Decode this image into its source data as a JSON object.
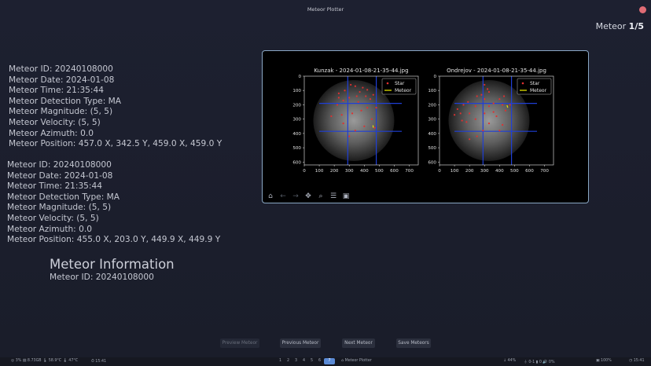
{
  "window": {
    "title": "Meteor Plotter"
  },
  "counter": {
    "label": "Meteor ",
    "value": "1/5"
  },
  "detections": [
    {
      "lines": [
        "Meteor ID: 20240108000",
        "Meteor Date: 2024-01-08",
        "Meteor Time: 21:35:44",
        "Meteor Detection Type: MA",
        "Meteor Magnitude: (5, 5)",
        "Meteor Velocity: (5, 5)",
        "Meteor Azimuth: 0.0",
        "Meteor Position: 457.0 X, 342.5 Y, 459.0 X, 459.0 Y"
      ]
    },
    {
      "lines": [
        "Meteor ID: 20240108000",
        "Meteor Date: 2024-01-08",
        "Meteor Time: 21:35:44",
        "Meteor Detection Type: MA",
        "Meteor Magnitude: (5, 5)",
        "Meteor Velocity: (5, 5)",
        "Meteor Azimuth: 0.0",
        "Meteor Position: 455.0 X, 203.0 Y, 449.9 X, 449.9 Y"
      ]
    }
  ],
  "meteor_info": {
    "title": "Meteor Information",
    "id_line": "Meteor ID: 20240108000"
  },
  "chart_data": [
    {
      "type": "scatter",
      "title": "Kunzak - 2024-01-08-21-35-44.jpg",
      "xticks": [
        "0",
        "100",
        "200",
        "300",
        "400",
        "500",
        "600",
        "700"
      ],
      "yticks": [
        "0",
        "100",
        "200",
        "300",
        "400",
        "500",
        "600"
      ],
      "xlim": [
        0,
        760
      ],
      "ylim": [
        620,
        0
      ],
      "legend": [
        "Star",
        "Meteor"
      ],
      "grid_lines": {
        "x": [
          290,
          480
        ],
        "y": [
          190,
          385
        ]
      },
      "stars": [
        [
          230,
          120
        ],
        [
          270,
          100
        ],
        [
          310,
          60
        ],
        [
          340,
          70
        ],
        [
          370,
          110
        ],
        [
          390,
          80
        ],
        [
          420,
          95
        ],
        [
          410,
          140
        ],
        [
          440,
          160
        ],
        [
          460,
          130
        ],
        [
          300,
          150
        ],
        [
          260,
          170
        ],
        [
          220,
          200
        ],
        [
          180,
          280
        ],
        [
          250,
          270
        ],
        [
          320,
          260
        ],
        [
          380,
          240
        ],
        [
          420,
          220
        ],
        [
          480,
          220
        ],
        [
          360,
          180
        ],
        [
          450,
          300
        ],
        [
          400,
          350
        ],
        [
          300,
          420
        ],
        [
          260,
          330
        ],
        [
          340,
          380
        ],
        [
          470,
          360
        ],
        [
          230,
          150
        ],
        [
          350,
          140
        ]
      ],
      "meteor": [
        [
          458,
          343
        ],
        [
          460,
          360
        ]
      ]
    },
    {
      "type": "scatter",
      "title": "Ondrejov - 2024-01-08-21-35-44.jpg",
      "xticks": [
        "0",
        "100",
        "200",
        "300",
        "400",
        "500",
        "600",
        "700"
      ],
      "yticks": [
        "0",
        "100",
        "200",
        "300",
        "400",
        "500",
        "600"
      ],
      "xlim": [
        0,
        760
      ],
      "ylim": [
        620,
        0
      ],
      "legend": [
        "Star",
        "Meteor"
      ],
      "grid_lines": {
        "x": [
          290,
          480
        ],
        "y": [
          190,
          385
        ]
      },
      "stars": [
        [
          300,
          60
        ],
        [
          320,
          90
        ],
        [
          280,
          130
        ],
        [
          250,
          140
        ],
        [
          190,
          180
        ],
        [
          160,
          200
        ],
        [
          120,
          230
        ],
        [
          100,
          270
        ],
        [
          150,
          310
        ],
        [
          200,
          260
        ],
        [
          240,
          300
        ],
        [
          300,
          260
        ],
        [
          330,
          210
        ],
        [
          360,
          190
        ],
        [
          400,
          160
        ],
        [
          420,
          200
        ],
        [
          440,
          240
        ],
        [
          380,
          280
        ],
        [
          330,
          330
        ],
        [
          290,
          380
        ],
        [
          250,
          420
        ],
        [
          200,
          440
        ],
        [
          420,
          340
        ],
        [
          470,
          200
        ],
        [
          360,
          250
        ],
        [
          300,
          160
        ],
        [
          430,
          140
        ],
        [
          240,
          210
        ],
        [
          180,
          320
        ],
        [
          140,
          260
        ],
        [
          400,
          380
        ],
        [
          330,
          110
        ]
      ],
      "meteor": [
        [
          450,
          203
        ],
        [
          455,
          220
        ]
      ]
    }
  ],
  "toolbar": {
    "icons": [
      "home-icon",
      "back-icon",
      "forward-icon",
      "pan-icon",
      "zoom-icon",
      "configure-icon",
      "save-icon"
    ]
  },
  "buttons": {
    "preview": "Preview Meteor",
    "previous": "Previous Meteor",
    "next": "Next Meteor",
    "save": "Save Meteors"
  },
  "taskbar": {
    "cpu": "◎ 3%  ▤ 8.73GB  🌡 58.9°C  🌡 47°C",
    "clock": "⏱ 15:41",
    "workspaces": [
      "1",
      "2",
      "3",
      "4",
      "5",
      "6",
      "7"
    ],
    "active_ws": "7",
    "app": "⌂ Meteor Plotter",
    "net": "↓ 44%",
    "tray": "⏚ 0-1  ▮ 0  🔊 0%",
    "battery": "▣ 100%",
    "date": "◷ 15:41"
  }
}
